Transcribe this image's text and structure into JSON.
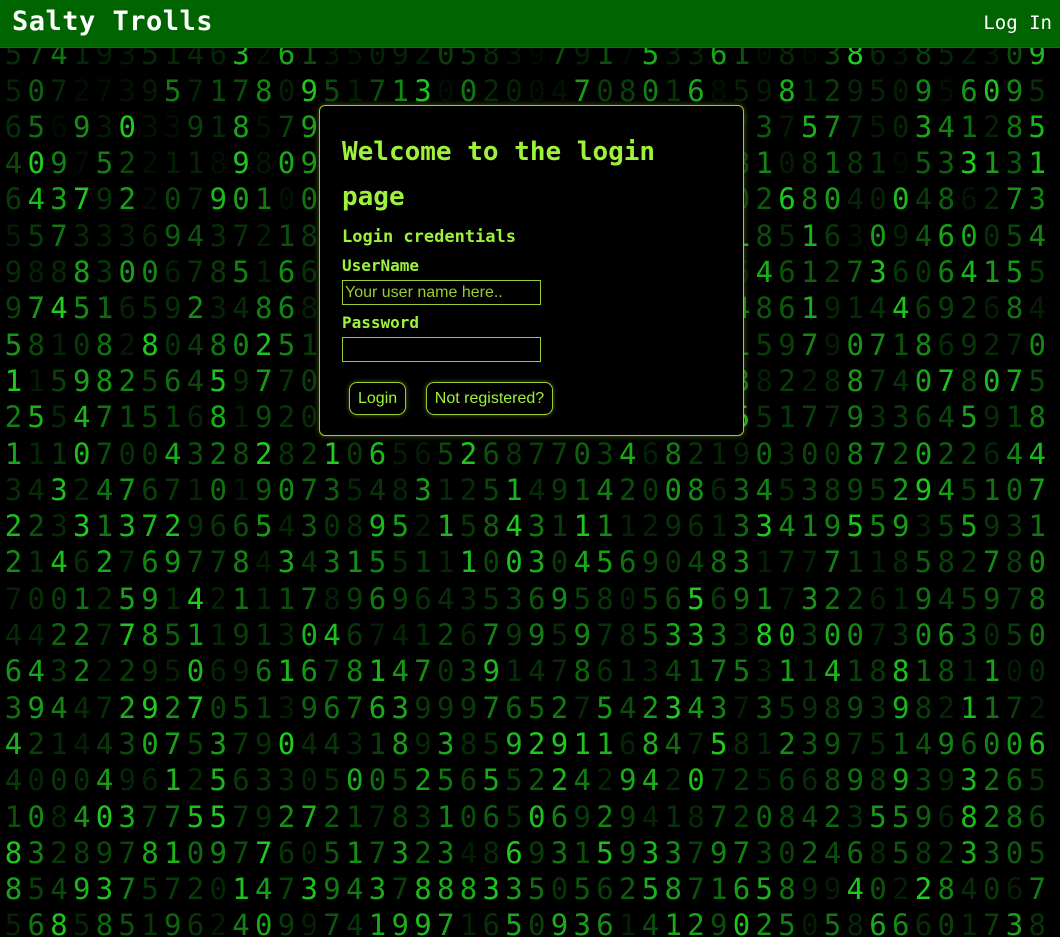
{
  "navbar": {
    "brand": "Salty Trolls",
    "login_link": "Log In",
    "color": "#006400"
  },
  "login_panel": {
    "title": "Welcome to the login page",
    "subtitle": "Login credentials",
    "username_label": "UserName",
    "username_placeholder": "Your user name here..",
    "username_value": "",
    "password_label": "Password",
    "password_value": "",
    "login_button": "Login",
    "register_button": "Not registered?",
    "accent_color": "#9ef23a"
  },
  "background": {
    "style": "matrix-digital-rain",
    "color": "#1fd11f"
  }
}
